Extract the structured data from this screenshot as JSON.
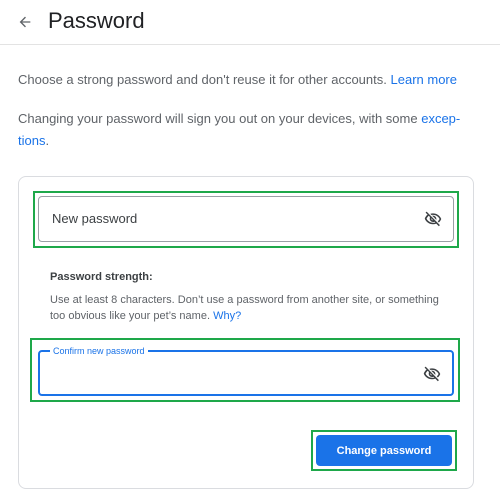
{
  "header": {
    "back_icon": "arrow-back-icon",
    "title": "Password"
  },
  "info": {
    "line1_text": "Choose a strong password and don't reuse it for other accounts.",
    "learn_more_label": "Learn more",
    "line2_text_a": "Changing your password will sign you out on your devices, with some",
    "exceptions_label_a": "excep-",
    "exceptions_label_b": "tions",
    "line2_end": "."
  },
  "form": {
    "new_password": {
      "placeholder": "New password",
      "value": "",
      "visibility_icon": "eye-off-icon"
    },
    "strength": {
      "title": "Password strength:",
      "hint": "Use at least 8 characters. Don’t use a password from another site, or something too obvious like your pet’s name.",
      "why_label": "Why?"
    },
    "confirm_password": {
      "label": "Confirm new password",
      "value": "",
      "visibility_icon": "eye-off-icon"
    },
    "submit_label": "Change password"
  },
  "colors": {
    "accent": "#1a73e8",
    "highlight": "#1ea84a",
    "text": "#5f6368",
    "title": "#202124"
  }
}
